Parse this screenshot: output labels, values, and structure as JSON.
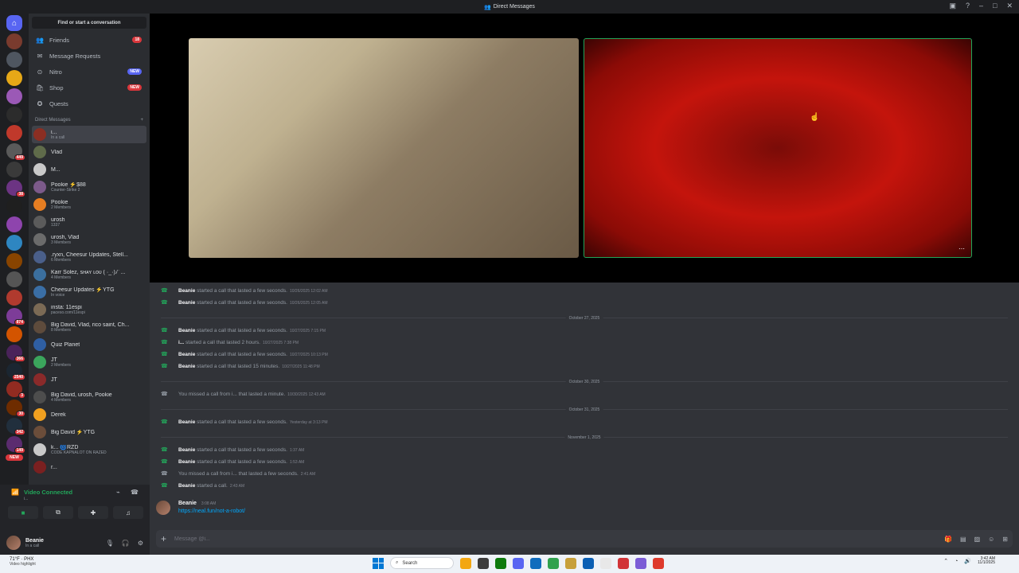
{
  "window": {
    "title": "Direct Messages"
  },
  "rail": {
    "servers": [
      {
        "color": "#7a3b2e",
        "badge": ""
      },
      {
        "color": "#4f5660",
        "badge": ""
      },
      {
        "color": "#e6a817",
        "badge": ""
      },
      {
        "color": "#9b59b6",
        "badge": ""
      },
      {
        "color": "#2c2c2c",
        "badge": ""
      },
      {
        "color": "#c0392b",
        "badge": ""
      },
      {
        "color": "#5a5a5a",
        "badge": "449"
      },
      {
        "color": "#3a3a3a",
        "badge": ""
      },
      {
        "color": "#6c3483",
        "badge": "38"
      },
      {
        "color": "#1f1f1f",
        "badge": ""
      },
      {
        "color": "#8e44ad",
        "badge": ""
      },
      {
        "color": "#2e86c1",
        "badge": ""
      },
      {
        "color": "#884400",
        "badge": ""
      },
      {
        "color": "#555555",
        "badge": ""
      },
      {
        "color": "#b03a2e",
        "badge": ""
      },
      {
        "color": "#7d3c98",
        "badge": "874"
      },
      {
        "color": "#d35400",
        "badge": ""
      },
      {
        "color": "#4a235a",
        "badge": "366"
      },
      {
        "color": "#1b2631",
        "badge": "2540"
      },
      {
        "color": "#922b21",
        "badge": "3"
      },
      {
        "color": "#6e2c00",
        "badge": "30"
      },
      {
        "color": "#212f3d",
        "badge": "342"
      },
      {
        "color": "#5b2c6f",
        "badge": "149"
      },
      {
        "color": "#da373c",
        "badge": "NEW"
      }
    ]
  },
  "sidebar": {
    "find_label": "Find or start a conversation",
    "nav": [
      {
        "label": "Friends",
        "icon": "👥",
        "pill": "18",
        "pill_color": "#da373c"
      },
      {
        "label": "Message Requests",
        "icon": "✉",
        "pill": "",
        "pill_color": ""
      },
      {
        "label": "Nitro",
        "icon": "⊙",
        "pill": "NEW",
        "pill_color": "#5865f2"
      },
      {
        "label": "Shop",
        "icon": "🛍",
        "pill": "NEW",
        "pill_color": "#da373c"
      },
      {
        "label": "Quests",
        "icon": "✪",
        "pill": "",
        "pill_color": ""
      }
    ],
    "dm_header": "Direct Messages",
    "dms": [
      {
        "name": "i...",
        "sub": "In a call",
        "color": "#8b2e22",
        "active": true
      },
      {
        "name": "Vlad",
        "sub": "",
        "color": "#5f6b4a",
        "active": false
      },
      {
        "name": "M...",
        "sub": "",
        "color": "#c9c9c9",
        "active": false
      },
      {
        "name": "Pookie ⚡$88",
        "sub": "Counter-Strike 2",
        "color": "#7c5a8a",
        "active": false
      },
      {
        "name": "Pookie",
        "sub": "2 Members",
        "color": "#e67e22",
        "active": false
      },
      {
        "name": "urosh",
        "sub": "1337",
        "color": "#5b5b5b",
        "active": false
      },
      {
        "name": "urosh, Vlad",
        "sub": "3 Members",
        "color": "#6b6b6b",
        "active": false
      },
      {
        "name": ".ryxn, Cheesur Updates, Stell...",
        "sub": "6 Members",
        "color": "#4a5f8a",
        "active": false
      },
      {
        "name": "Karr Solez, ꜱʜᴀʏ ʟᴏᴜ ( ·_·)ﾉﾞ...",
        "sub": "4 Members",
        "color": "#3b6f9e",
        "active": false
      },
      {
        "name": "Cheesur Updates ⚡YTG",
        "sub": "In voice",
        "color": "#3a6ea5",
        "active": false
      },
      {
        "name": "insta: 11espi",
        "sub": "paceso.com/11espi",
        "color": "#7b6a55",
        "active": false
      },
      {
        "name": "Big David, Vlad, rico saint, Ch...",
        "sub": "8 Members",
        "color": "#5e4b3c",
        "active": false
      },
      {
        "name": "Quiz Planet",
        "sub": "",
        "color": "#2f5fa3",
        "active": false
      },
      {
        "name": "JT",
        "sub": "2 Members",
        "color": "#3ba55c",
        "active": false
      },
      {
        "name": "JT",
        "sub": "",
        "color": "#8a2a2a",
        "active": false
      },
      {
        "name": "Big David, urosh, Pookie",
        "sub": "4 Members",
        "color": "#4d4d4d",
        "active": false
      },
      {
        "name": "Derek",
        "sub": "",
        "color": "#f0a020",
        "active": false
      },
      {
        "name": "Big David ⚡YTG",
        "sub": "",
        "color": "#6b4d3a",
        "active": false
      },
      {
        "name": "k... 🌀RZD",
        "sub": "CODE KAPNALOT ON RAZED",
        "color": "#c9c9c9",
        "active": false
      },
      {
        "name": "r...",
        "sub": "",
        "color": "#7a2020",
        "active": false
      }
    ]
  },
  "voice": {
    "status": "Video Connected",
    "sub": "i..."
  },
  "user": {
    "name": "Beanie",
    "status": "In a call"
  },
  "chat": {
    "messages": [
      {
        "type": "call",
        "who": "Beanie",
        "what": "started a call that lasted a few seconds.",
        "when": "10/26/2025 12:02 AM",
        "missed": false
      },
      {
        "type": "call",
        "who": "Beanie",
        "what": "started a call that lasted a few seconds.",
        "when": "10/26/2025 12:05 AM",
        "missed": false
      },
      {
        "type": "divider",
        "label": "October 27, 2025"
      },
      {
        "type": "call",
        "who": "Beanie",
        "what": "started a call that lasted a few seconds.",
        "when": "10/27/2025 7:15 PM",
        "missed": false
      },
      {
        "type": "call",
        "who": "i...",
        "what": "started a call that lasted 2 hours.",
        "when": "10/27/2025 7:38 PM",
        "missed": false
      },
      {
        "type": "call",
        "who": "Beanie",
        "what": "started a call that lasted a few seconds.",
        "when": "10/27/2025 10:13 PM",
        "missed": false
      },
      {
        "type": "call",
        "who": "Beanie",
        "what": "started a call that lasted 15 minutes.",
        "when": "10/27/2025 11:48 PM",
        "missed": false
      },
      {
        "type": "divider",
        "label": "October 30, 2025"
      },
      {
        "type": "call",
        "who": "",
        "what": "You missed a call from i... that lasted a minute.",
        "when": "10/30/2025 12:43 AM",
        "missed": true
      },
      {
        "type": "divider",
        "label": "October 31, 2025"
      },
      {
        "type": "call",
        "who": "Beanie",
        "what": "started a call that lasted a few seconds.",
        "when": "Yesterday at 3:13 PM",
        "missed": false
      },
      {
        "type": "divider",
        "label": "November 1, 2025"
      },
      {
        "type": "call",
        "who": "Beanie",
        "what": "started a call that lasted a few seconds.",
        "when": "1:37 AM",
        "missed": false
      },
      {
        "type": "call",
        "who": "Beanie",
        "what": "started a call that lasted a few seconds.",
        "when": "1:53 AM",
        "missed": false
      },
      {
        "type": "call",
        "who": "",
        "what": "You missed a call from i... that lasted a few seconds.",
        "when": "2:41 AM",
        "missed": true
      },
      {
        "type": "call",
        "who": "Beanie",
        "what": "started a call.",
        "when": "2:43 AM",
        "missed": false
      }
    ],
    "last_message": {
      "author": "Beanie",
      "time": "3:08 AM",
      "link": "https://neal.fun/not-a-robot/"
    },
    "composer_placeholder": "Message @i..."
  },
  "taskbar": {
    "weather_temp": "71°F · PHX",
    "weather_sub": "Video highlight",
    "search_label": "Search",
    "time": "3:42 AM",
    "date": "11/1/2025",
    "apps": [
      "#f3a712",
      "#3c3c3c",
      "#0e7a0d",
      "#5865f2",
      "#0f6cbd",
      "#30a14e",
      "#c7a03a",
      "#0a5fb4",
      "#e8e8e8",
      "#d13438",
      "#7b5cd6",
      "#de3a2c"
    ]
  }
}
